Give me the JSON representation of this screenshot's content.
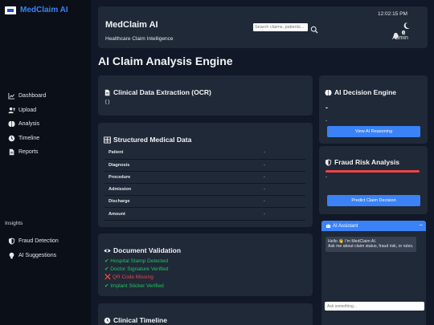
{
  "brand": {
    "name": "MedClaim AI"
  },
  "sidebar": {
    "items": [
      {
        "label": "Dashboard",
        "icon": "chart-line-icon"
      },
      {
        "label": "Upload",
        "icon": "upload-user-icon"
      },
      {
        "label": "Analysis",
        "icon": "brain-icon"
      },
      {
        "label": "Timeline",
        "icon": "clock-icon"
      },
      {
        "label": "Reports",
        "icon": "file-icon"
      }
    ],
    "insights_title": "Insights",
    "insights": [
      {
        "label": "Fraud Detection",
        "icon": "shield-icon"
      },
      {
        "label": "AI Suggestions",
        "icon": "lightbulb-icon"
      }
    ]
  },
  "header": {
    "title": "MedClaim AI",
    "subtitle": "Healthcare Claim Intelligence",
    "search_placeholder": "Search claims, patients...",
    "clock": "12:02:15 PM",
    "notification_count": "3",
    "user": "Admin"
  },
  "page_title": "AI Claim Analysis Engine",
  "ocr": {
    "title": "Clinical Data Extraction (OCR)",
    "json": "{}"
  },
  "structured": {
    "title": "Structured Medical Data",
    "rows": [
      {
        "label": "Patient",
        "value": "-"
      },
      {
        "label": "Diagnosis",
        "value": "-"
      },
      {
        "label": "Procedure",
        "value": "-"
      },
      {
        "label": "Admission",
        "value": "-"
      },
      {
        "label": "Discharge",
        "value": "-"
      },
      {
        "label": "Amount",
        "value": "-"
      }
    ]
  },
  "validation": {
    "title": "Document Validation",
    "items": [
      {
        "text": "✔ Hospital Stamp Detected",
        "status": "ok"
      },
      {
        "text": "✔ Doctor Signature Verified",
        "status": "ok"
      },
      {
        "text": "❌ QR Code Missing",
        "status": "bad"
      },
      {
        "text": "✔ Implant Sticker Verified",
        "status": "ok"
      }
    ]
  },
  "timeline": {
    "title": "Clinical Timeline"
  },
  "decision": {
    "title": "AI Decision Engine",
    "value": "-",
    "detail": "-",
    "button": "View AI Reasoning"
  },
  "fraud": {
    "title": "Fraud Risk Analysis",
    "risk_fraction": 1.0,
    "value": "-",
    "button": "Predict Claim Decision"
  },
  "assistant": {
    "title": "AI Assistant",
    "minimize": "−",
    "message_line1": "Hello 👋 I'm MedClaim AI.",
    "message_line2": "Ask me about claim status, fraud risk, or rules.",
    "input_placeholder": "Ask something..."
  },
  "colors": {
    "accent": "#3b82f6",
    "ok": "#22c55e",
    "danger": "#ef4444",
    "card": "#1f2937"
  }
}
